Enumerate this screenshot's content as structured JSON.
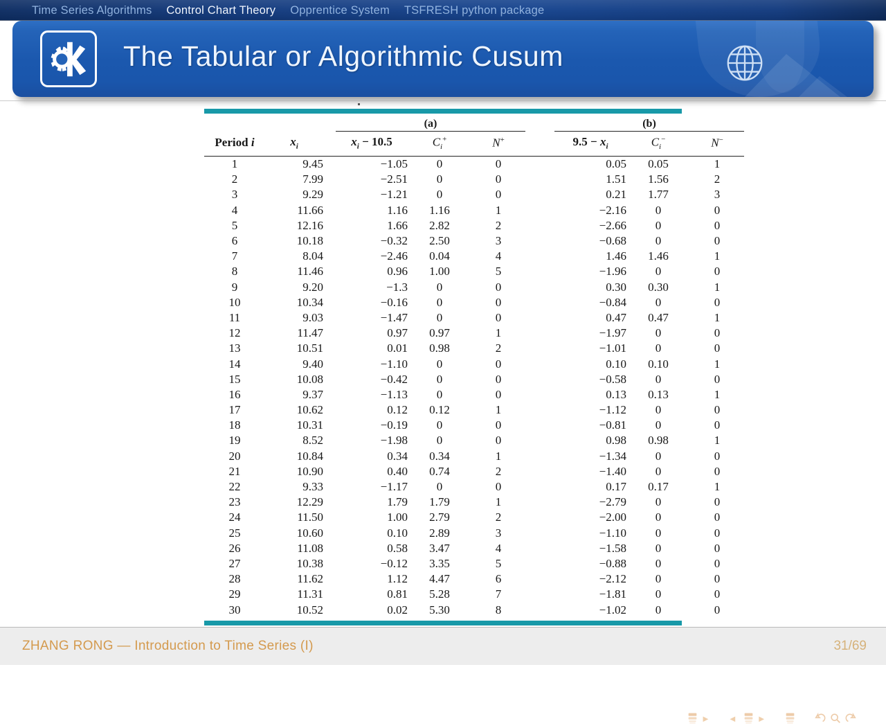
{
  "nav": {
    "items": [
      {
        "label": "Time Series Algorithms",
        "active": false
      },
      {
        "label": "Control Chart Theory",
        "active": true
      },
      {
        "label": "Opprentice System",
        "active": false
      },
      {
        "label": "TSFRESH python package",
        "active": false
      }
    ]
  },
  "banner": {
    "title": "The Tabular or Algorithmic Cusum",
    "logo_name": "kde-logo",
    "globe_name": "globe-icon",
    "bg_color": "#1b58ae",
    "title_color": "#eef5ff"
  },
  "figure": {
    "rule_color": "#1899a8",
    "group_headers": [
      {
        "label": "(a)",
        "span": 3
      },
      {
        "label": "(b)",
        "span": 3
      }
    ],
    "columns": [
      "Period i",
      "x_i",
      "x_i − 10.5",
      "C_i^+",
      "N^+",
      "9.5 − x_i",
      "C_i^−",
      "N^−"
    ]
  },
  "chart_data": {
    "type": "table",
    "title": "Tabular (Algorithmic) Cusum worksheet",
    "columns": [
      "Period i",
      "xi",
      "xi - 10.5",
      "Ci+",
      "N+",
      "9.5 - xi",
      "Ci-",
      "N-"
    ],
    "rows": [
      [
        "1",
        "9.45",
        "−1.05",
        "0",
        "0",
        "0.05",
        "0.05",
        "1"
      ],
      [
        "2",
        "7.99",
        "−2.51",
        "0",
        "0",
        "1.51",
        "1.56",
        "2"
      ],
      [
        "3",
        "9.29",
        "−1.21",
        "0",
        "0",
        "0.21",
        "1.77",
        "3"
      ],
      [
        "4",
        "11.66",
        "1.16",
        "1.16",
        "1",
        "−2.16",
        "0",
        "0"
      ],
      [
        "5",
        "12.16",
        "1.66",
        "2.82",
        "2",
        "−2.66",
        "0",
        "0"
      ],
      [
        "6",
        "10.18",
        "−0.32",
        "2.50",
        "3",
        "−0.68",
        "0",
        "0"
      ],
      [
        "7",
        "8.04",
        "−2.46",
        "0.04",
        "4",
        "1.46",
        "1.46",
        "1"
      ],
      [
        "8",
        "11.46",
        "0.96",
        "1.00",
        "5",
        "−1.96",
        "0",
        "0"
      ],
      [
        "9",
        "9.20",
        "−1.3",
        "0",
        "0",
        "0.30",
        "0.30",
        "1"
      ],
      [
        "10",
        "10.34",
        "−0.16",
        "0",
        "0",
        "−0.84",
        "0",
        "0"
      ],
      [
        "11",
        "9.03",
        "−1.47",
        "0",
        "0",
        "0.47",
        "0.47",
        "1"
      ],
      [
        "12",
        "11.47",
        "0.97",
        "0.97",
        "1",
        "−1.97",
        "0",
        "0"
      ],
      [
        "13",
        "10.51",
        "0.01",
        "0.98",
        "2",
        "−1.01",
        "0",
        "0"
      ],
      [
        "14",
        "9.40",
        "−1.10",
        "0",
        "0",
        "0.10",
        "0.10",
        "1"
      ],
      [
        "15",
        "10.08",
        "−0.42",
        "0",
        "0",
        "−0.58",
        "0",
        "0"
      ],
      [
        "16",
        "9.37",
        "−1.13",
        "0",
        "0",
        "0.13",
        "0.13",
        "1"
      ],
      [
        "17",
        "10.62",
        "0.12",
        "0.12",
        "1",
        "−1.12",
        "0",
        "0"
      ],
      [
        "18",
        "10.31",
        "−0.19",
        "0",
        "0",
        "−0.81",
        "0",
        "0"
      ],
      [
        "19",
        "8.52",
        "−1.98",
        "0",
        "0",
        "0.98",
        "0.98",
        "1"
      ],
      [
        "20",
        "10.84",
        "0.34",
        "0.34",
        "1",
        "−1.34",
        "0",
        "0"
      ],
      [
        "21",
        "10.90",
        "0.40",
        "0.74",
        "2",
        "−1.40",
        "0",
        "0"
      ],
      [
        "22",
        "9.33",
        "−1.17",
        "0",
        "0",
        "0.17",
        "0.17",
        "1"
      ],
      [
        "23",
        "12.29",
        "1.79",
        "1.79",
        "1",
        "−2.79",
        "0",
        "0"
      ],
      [
        "24",
        "11.50",
        "1.00",
        "2.79",
        "2",
        "−2.00",
        "0",
        "0"
      ],
      [
        "25",
        "10.60",
        "0.10",
        "2.89",
        "3",
        "−1.10",
        "0",
        "0"
      ],
      [
        "26",
        "11.08",
        "0.58",
        "3.47",
        "4",
        "−1.58",
        "0",
        "0"
      ],
      [
        "27",
        "10.38",
        "−0.12",
        "3.35",
        "5",
        "−0.88",
        "0",
        "0"
      ],
      [
        "28",
        "11.62",
        "1.12",
        "4.47",
        "6",
        "−2.12",
        "0",
        "0"
      ],
      [
        "29",
        "11.31",
        "0.81",
        "5.28",
        "7",
        "−1.81",
        "0",
        "0"
      ],
      [
        "30",
        "10.52",
        "0.02",
        "5.30",
        "8",
        "−1.02",
        "0",
        "0"
      ]
    ]
  },
  "nav_symbols": {
    "items": [
      "first-slide-icon",
      "next-slide-arrow",
      "prev-frame-arrow",
      "frame-icon",
      "next-frame-arrow",
      "last-slide-icon",
      "back-icon",
      "search-icon",
      "forward-icon"
    ]
  },
  "footer": {
    "left": "ZHANG RONG — Introduction to Time Series (I)",
    "right": "31/69",
    "text_color": "#d49a4e",
    "bg_color": "#ededed"
  }
}
